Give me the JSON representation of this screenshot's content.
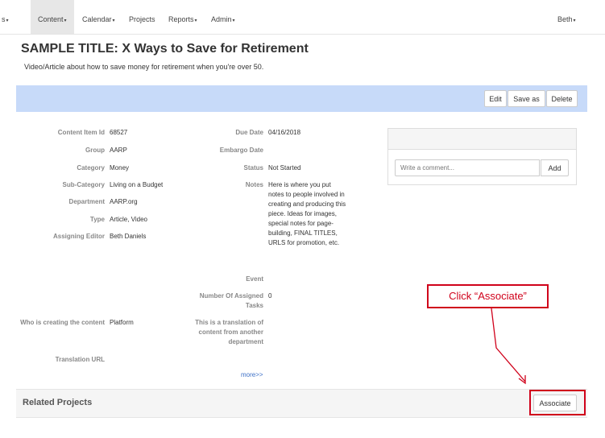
{
  "nav": {
    "items": [
      {
        "label": "s",
        "caret": true
      },
      {
        "label": "Content",
        "caret": true
      },
      {
        "label": "Calendar",
        "caret": true
      },
      {
        "label": "Projects",
        "caret": false
      },
      {
        "label": "Reports",
        "caret": true
      },
      {
        "label": "Admin",
        "caret": true
      }
    ],
    "user": "Beth",
    "caret_glyph": "▾"
  },
  "page": {
    "title": "SAMPLE TITLE: X Ways to Save for Retirement",
    "subtitle": "Video/Article about how to save money for retirement when you're over 50."
  },
  "toolbar": {
    "edit": "Edit",
    "save_as": "Save as",
    "delete": "Delete"
  },
  "details_left": [
    {
      "label": "Content Item Id",
      "value": "68527"
    },
    {
      "label": "Group",
      "value": "AARP"
    },
    {
      "label": "Category",
      "value": "Money"
    },
    {
      "label": "Sub-Category",
      "value": "Living on a Budget"
    },
    {
      "label": "Department",
      "value": "AARP.org"
    },
    {
      "label": "Type",
      "value": "Article, Video"
    },
    {
      "label": "Assigning Editor",
      "value": "Beth Daniels"
    },
    {
      "label": "Who is creating the content",
      "value": "Platform"
    },
    {
      "label": "Translation URL",
      "value": ""
    }
  ],
  "details_right": [
    {
      "label": "Due Date",
      "value": "04/16/2018"
    },
    {
      "label": "Embargo Date",
      "value": ""
    },
    {
      "label": "Status",
      "value": "Not Started"
    },
    {
      "label": "Notes",
      "value": "Here is where you put notes to people involved in creating and producing this piece. Ideas for images, special notes for page-building, FINAL TITLES, URLS for promotion, etc."
    },
    {
      "label": "Event",
      "value": ""
    },
    {
      "label": "Number Of Assigned Tasks",
      "value": "0"
    },
    {
      "label": "This is a translation of content from another department",
      "value": ""
    }
  ],
  "more_link": "more>>",
  "comment": {
    "placeholder": "Write a comment...",
    "add": "Add"
  },
  "related": {
    "title": "Related Projects",
    "associate": "Associate"
  },
  "callout": {
    "text": "Click “Associate”"
  },
  "colors": {
    "callout": "#d0021b",
    "toolbar_bg": "#c7daf9",
    "link": "#3b6fc6"
  }
}
